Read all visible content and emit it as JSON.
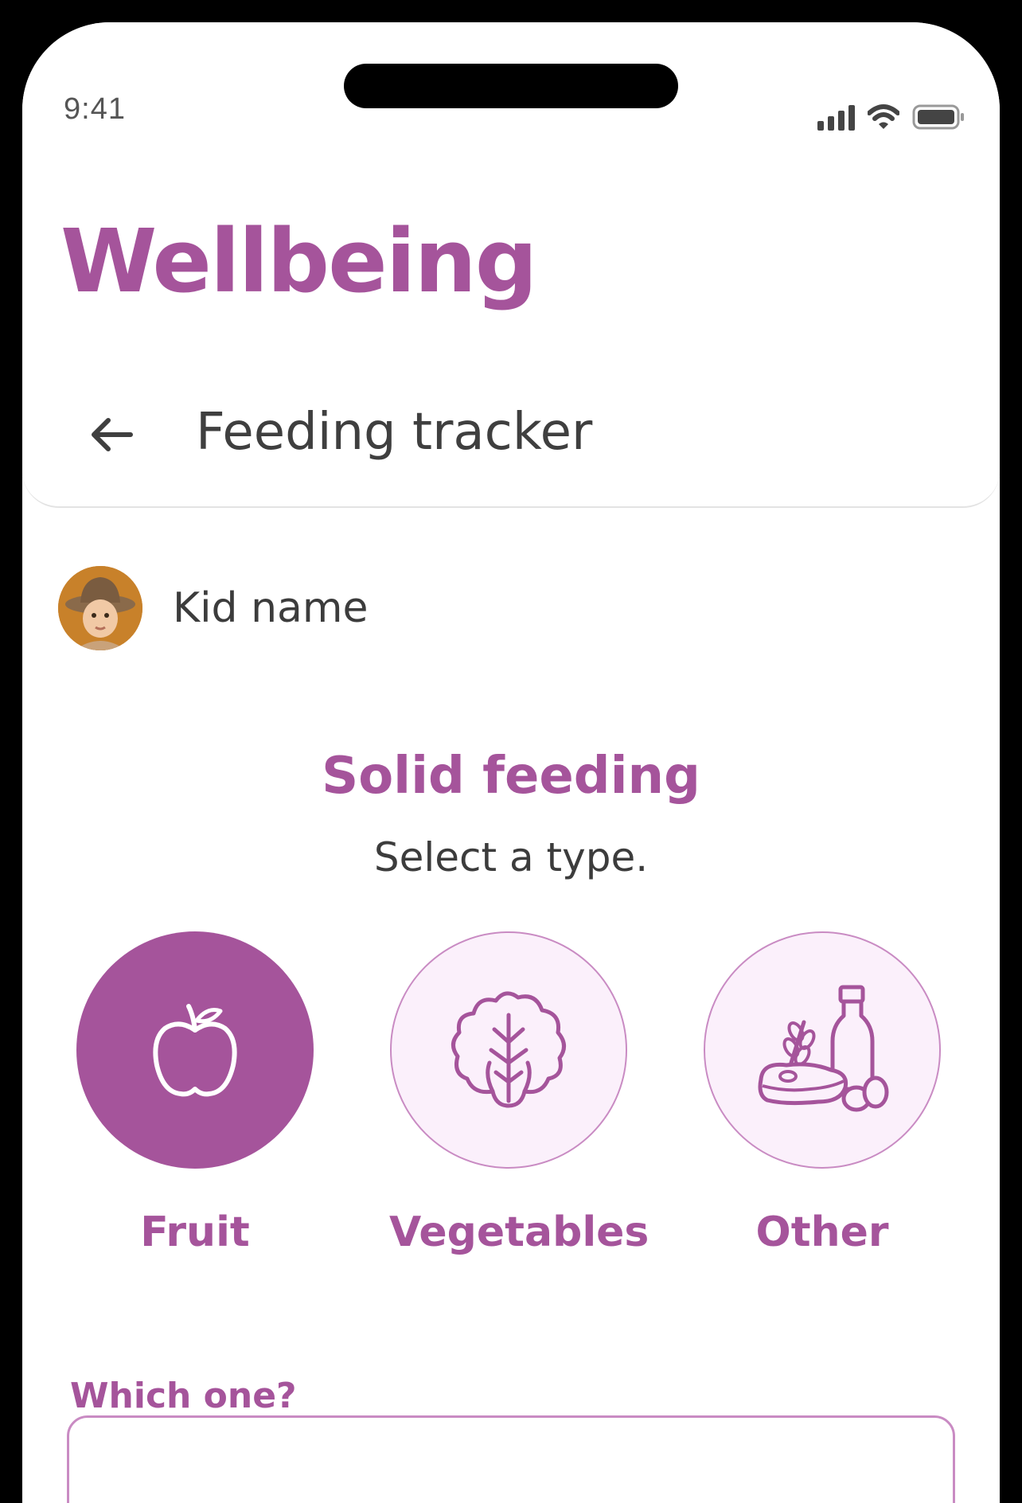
{
  "status_bar": {
    "time": "9:41"
  },
  "app": {
    "title": "Wellbeing"
  },
  "header": {
    "title": "Feeding tracker",
    "back_icon": "arrow-left-icon"
  },
  "kid": {
    "name": "Kid name",
    "avatar": "baby-avatar"
  },
  "section": {
    "title": "Solid feeding",
    "subtitle": "Select a type."
  },
  "types": [
    {
      "label": "Fruit",
      "icon": "apple-icon",
      "selected": true
    },
    {
      "label": "Vegetables",
      "icon": "lettuce-icon",
      "selected": false
    },
    {
      "label": "Other",
      "icon": "other-food-icon",
      "selected": false
    }
  ],
  "which": {
    "label": "Which one?"
  },
  "colors": {
    "accent": "#a5549b",
    "accent_light": "#fbf0fb",
    "border": "#c98bc3"
  }
}
